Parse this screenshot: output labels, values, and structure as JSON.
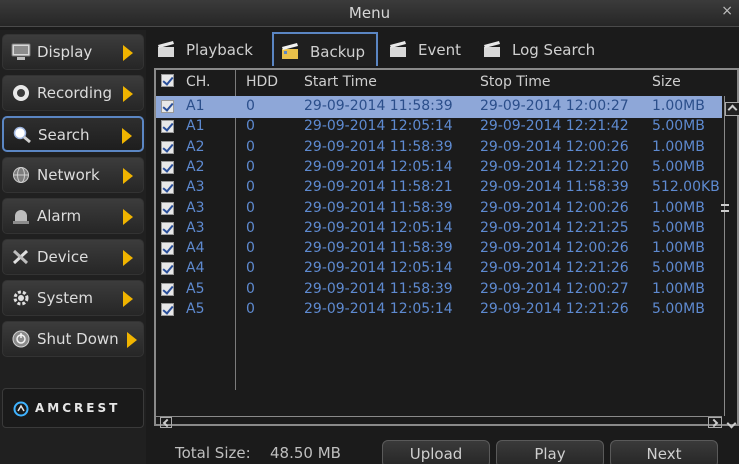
{
  "window": {
    "title": "Menu",
    "close_glyph": "×"
  },
  "sidebar": {
    "items": [
      {
        "label": "Display",
        "icon": "monitor-icon"
      },
      {
        "label": "Recording",
        "icon": "record-icon"
      },
      {
        "label": "Search",
        "icon": "search-icon",
        "active": true
      },
      {
        "label": "Network",
        "icon": "globe-icon"
      },
      {
        "label": "Alarm",
        "icon": "alarm-icon"
      },
      {
        "label": "Device",
        "icon": "tools-icon"
      },
      {
        "label": "System",
        "icon": "gear-icon"
      },
      {
        "label": "Shut Down",
        "icon": "power-icon"
      }
    ],
    "brand": "AMCREST"
  },
  "tabs": [
    {
      "label": "Playback",
      "icon": "clapper-icon"
    },
    {
      "label": "Backup",
      "icon": "clapper-icon",
      "active": true
    },
    {
      "label": "Event",
      "icon": "clapper-icon"
    },
    {
      "label": "Log Search",
      "icon": "clapper-icon"
    }
  ],
  "table": {
    "headers": {
      "ch": "CH.",
      "hdd": "HDD",
      "start": "Start Time",
      "stop": "Stop Time",
      "size": "Size"
    },
    "rows": [
      {
        "ch": "A1",
        "hdd": "0",
        "start": "29-09-2014 11:58:39",
        "stop": "29-09-2014 12:00:27",
        "size": "1.00MB"
      },
      {
        "ch": "A1",
        "hdd": "0",
        "start": "29-09-2014 12:05:14",
        "stop": "29-09-2014 12:21:42",
        "size": "5.00MB"
      },
      {
        "ch": "A2",
        "hdd": "0",
        "start": "29-09-2014 11:58:39",
        "stop": "29-09-2014 12:00:26",
        "size": "1.00MB"
      },
      {
        "ch": "A2",
        "hdd": "0",
        "start": "29-09-2014 12:05:14",
        "stop": "29-09-2014 12:21:20",
        "size": "5.00MB"
      },
      {
        "ch": "A3",
        "hdd": "0",
        "start": "29-09-2014 11:58:21",
        "stop": "29-09-2014 11:58:39",
        "size": "512.00KB"
      },
      {
        "ch": "A3",
        "hdd": "0",
        "start": "29-09-2014 11:58:39",
        "stop": "29-09-2014 12:00:26",
        "size": "1.00MB"
      },
      {
        "ch": "A3",
        "hdd": "0",
        "start": "29-09-2014 12:05:14",
        "stop": "29-09-2014 12:21:25",
        "size": "5.00MB"
      },
      {
        "ch": "A4",
        "hdd": "0",
        "start": "29-09-2014 11:58:39",
        "stop": "29-09-2014 12:00:26",
        "size": "1.00MB"
      },
      {
        "ch": "A4",
        "hdd": "0",
        "start": "29-09-2014 12:05:14",
        "stop": "29-09-2014 12:21:26",
        "size": "5.00MB"
      },
      {
        "ch": "A5",
        "hdd": "0",
        "start": "29-09-2014 11:58:39",
        "stop": "29-09-2014 12:00:27",
        "size": "1.00MB"
      },
      {
        "ch": "A5",
        "hdd": "0",
        "start": "29-09-2014 12:05:14",
        "stop": "29-09-2014 12:21:26",
        "size": "5.00MB"
      }
    ]
  },
  "footer": {
    "total_label": "Total Size:",
    "total_value": "48.50 MB",
    "upload_label": "Upload",
    "play_label": "Play",
    "next_label": "Next"
  },
  "colors": {
    "accent": "#5b86c3",
    "selected_row": "#8ea7d8",
    "cell_text": "#5e8ad0",
    "arrow": "#f0b400"
  }
}
